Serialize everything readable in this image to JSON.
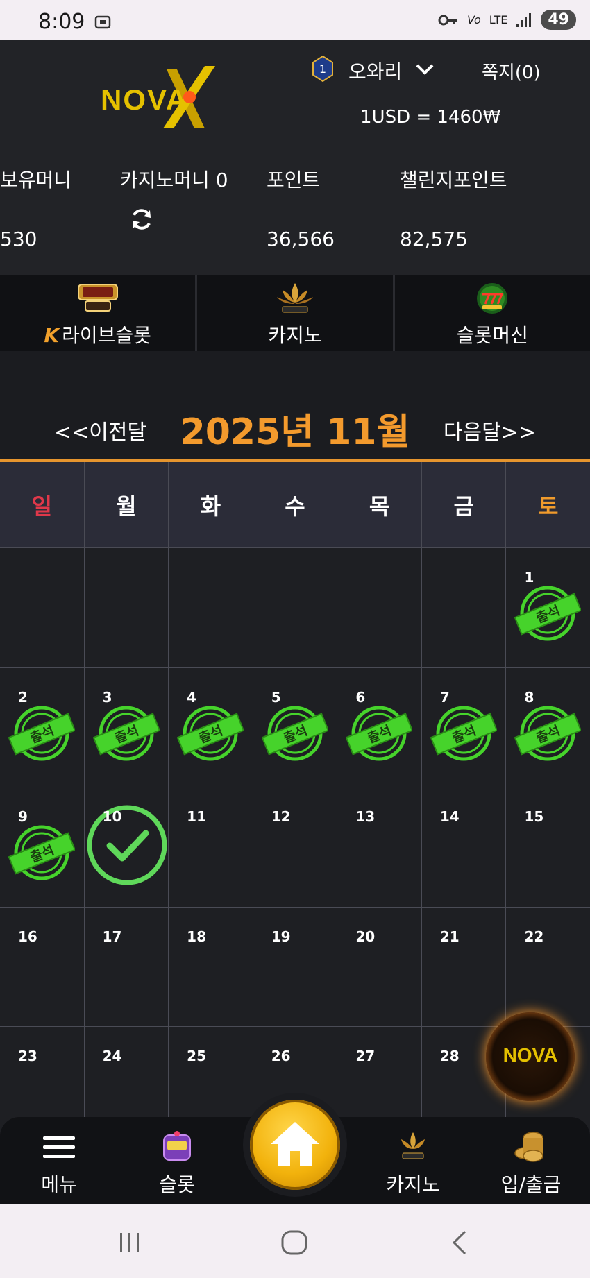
{
  "status_bar": {
    "time": "8:09",
    "network": "LTE",
    "battery": "49"
  },
  "header": {
    "logo_text": "NOVA",
    "rank": "1",
    "username": "오와리",
    "messages": "쪽지(0)",
    "exchange_rate": "1USD = 1460₩",
    "balances": [
      {
        "label": "보유머니",
        "value": "530"
      },
      {
        "label": "카지노머니 0",
        "value": ""
      },
      {
        "label": "포인트",
        "value": "36,566"
      },
      {
        "label": "챌린지포인트",
        "value": "82,575"
      }
    ]
  },
  "categories": [
    {
      "label": "라이브슬롯",
      "prefix": "K",
      "icon": "live-slot-icon"
    },
    {
      "label": "카지노",
      "icon": "k-slot-lotus-icon"
    },
    {
      "label": "슬롯머신",
      "icon": "777-slots-icon"
    }
  ],
  "calendar": {
    "prev_label": "<<이전달",
    "title": "2025년 11월",
    "next_label": "다음달>>",
    "weekdays": [
      "일",
      "월",
      "화",
      "수",
      "목",
      "금",
      "토"
    ],
    "stamp_text": "출석",
    "weeks": [
      [
        "",
        "",
        "",
        "",
        "",
        "",
        "1"
      ],
      [
        "2",
        "3",
        "4",
        "5",
        "6",
        "7",
        "8"
      ],
      [
        "9",
        "10",
        "11",
        "12",
        "13",
        "14",
        "15"
      ],
      [
        "16",
        "17",
        "18",
        "19",
        "20",
        "21",
        "22"
      ],
      [
        "23",
        "24",
        "25",
        "26",
        "27",
        "28",
        ""
      ]
    ],
    "attended": [
      "1",
      "2",
      "3",
      "4",
      "5",
      "6",
      "7",
      "8",
      "9"
    ],
    "today": "10"
  },
  "bottom_nav": {
    "menu": "메뉴",
    "slot": "슬롯",
    "casino": "카지노",
    "deposit": "입/출금"
  },
  "colors": {
    "accent_orange": "#f39a2d",
    "sunday_red": "#e0384a",
    "stamp_green": "#46d32b",
    "home_gold": "#f2b20c"
  }
}
